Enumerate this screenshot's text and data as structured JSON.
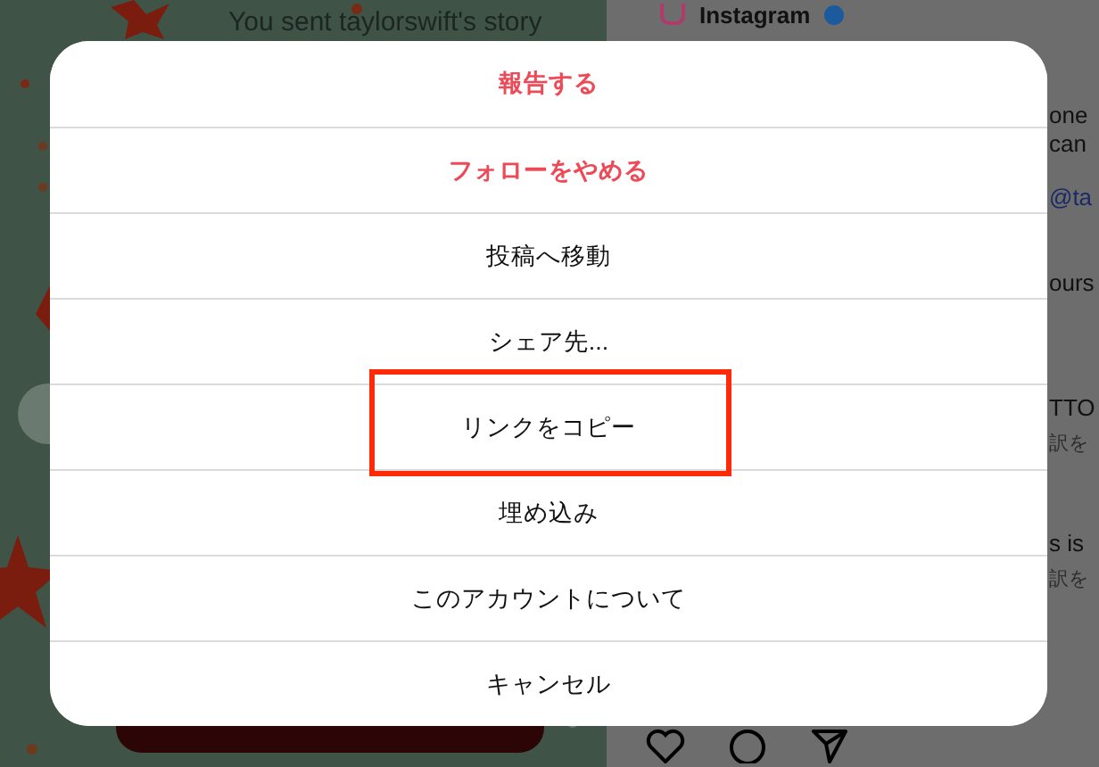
{
  "story": {
    "kind": "picture",
    "caption": "You sent taylorswift's story"
  },
  "post": {
    "account": "Instagram",
    "verified": true,
    "fragments": [
      {
        "text": "one",
        "kind": "plain"
      },
      {
        "text": "can",
        "kind": "plain"
      },
      {
        "text": "@ta",
        "kind": "link"
      },
      {
        "text": "ours",
        "kind": "plain"
      },
      {
        "text": "TTO",
        "kind": "plain"
      },
      {
        "text": "訳を",
        "kind": "muted"
      },
      {
        "text": "s is",
        "kind": "plain"
      },
      {
        "text": "訳を",
        "kind": "muted"
      }
    ]
  },
  "menu": {
    "items": [
      {
        "label": "報告する",
        "kind": "danger",
        "highlighted": false
      },
      {
        "label": "フォローをやめる",
        "kind": "danger",
        "highlighted": false
      },
      {
        "label": "投稿へ移動",
        "kind": "normal",
        "highlighted": false
      },
      {
        "label": "シェア先...",
        "kind": "normal",
        "highlighted": false
      },
      {
        "label": "リンクをコピー",
        "kind": "normal",
        "highlighted": true
      },
      {
        "label": "埋め込み",
        "kind": "normal",
        "highlighted": false
      },
      {
        "label": "このアカウントについて",
        "kind": "normal",
        "highlighted": false
      },
      {
        "label": "キャンセル",
        "kind": "normal",
        "highlighted": false
      }
    ]
  }
}
